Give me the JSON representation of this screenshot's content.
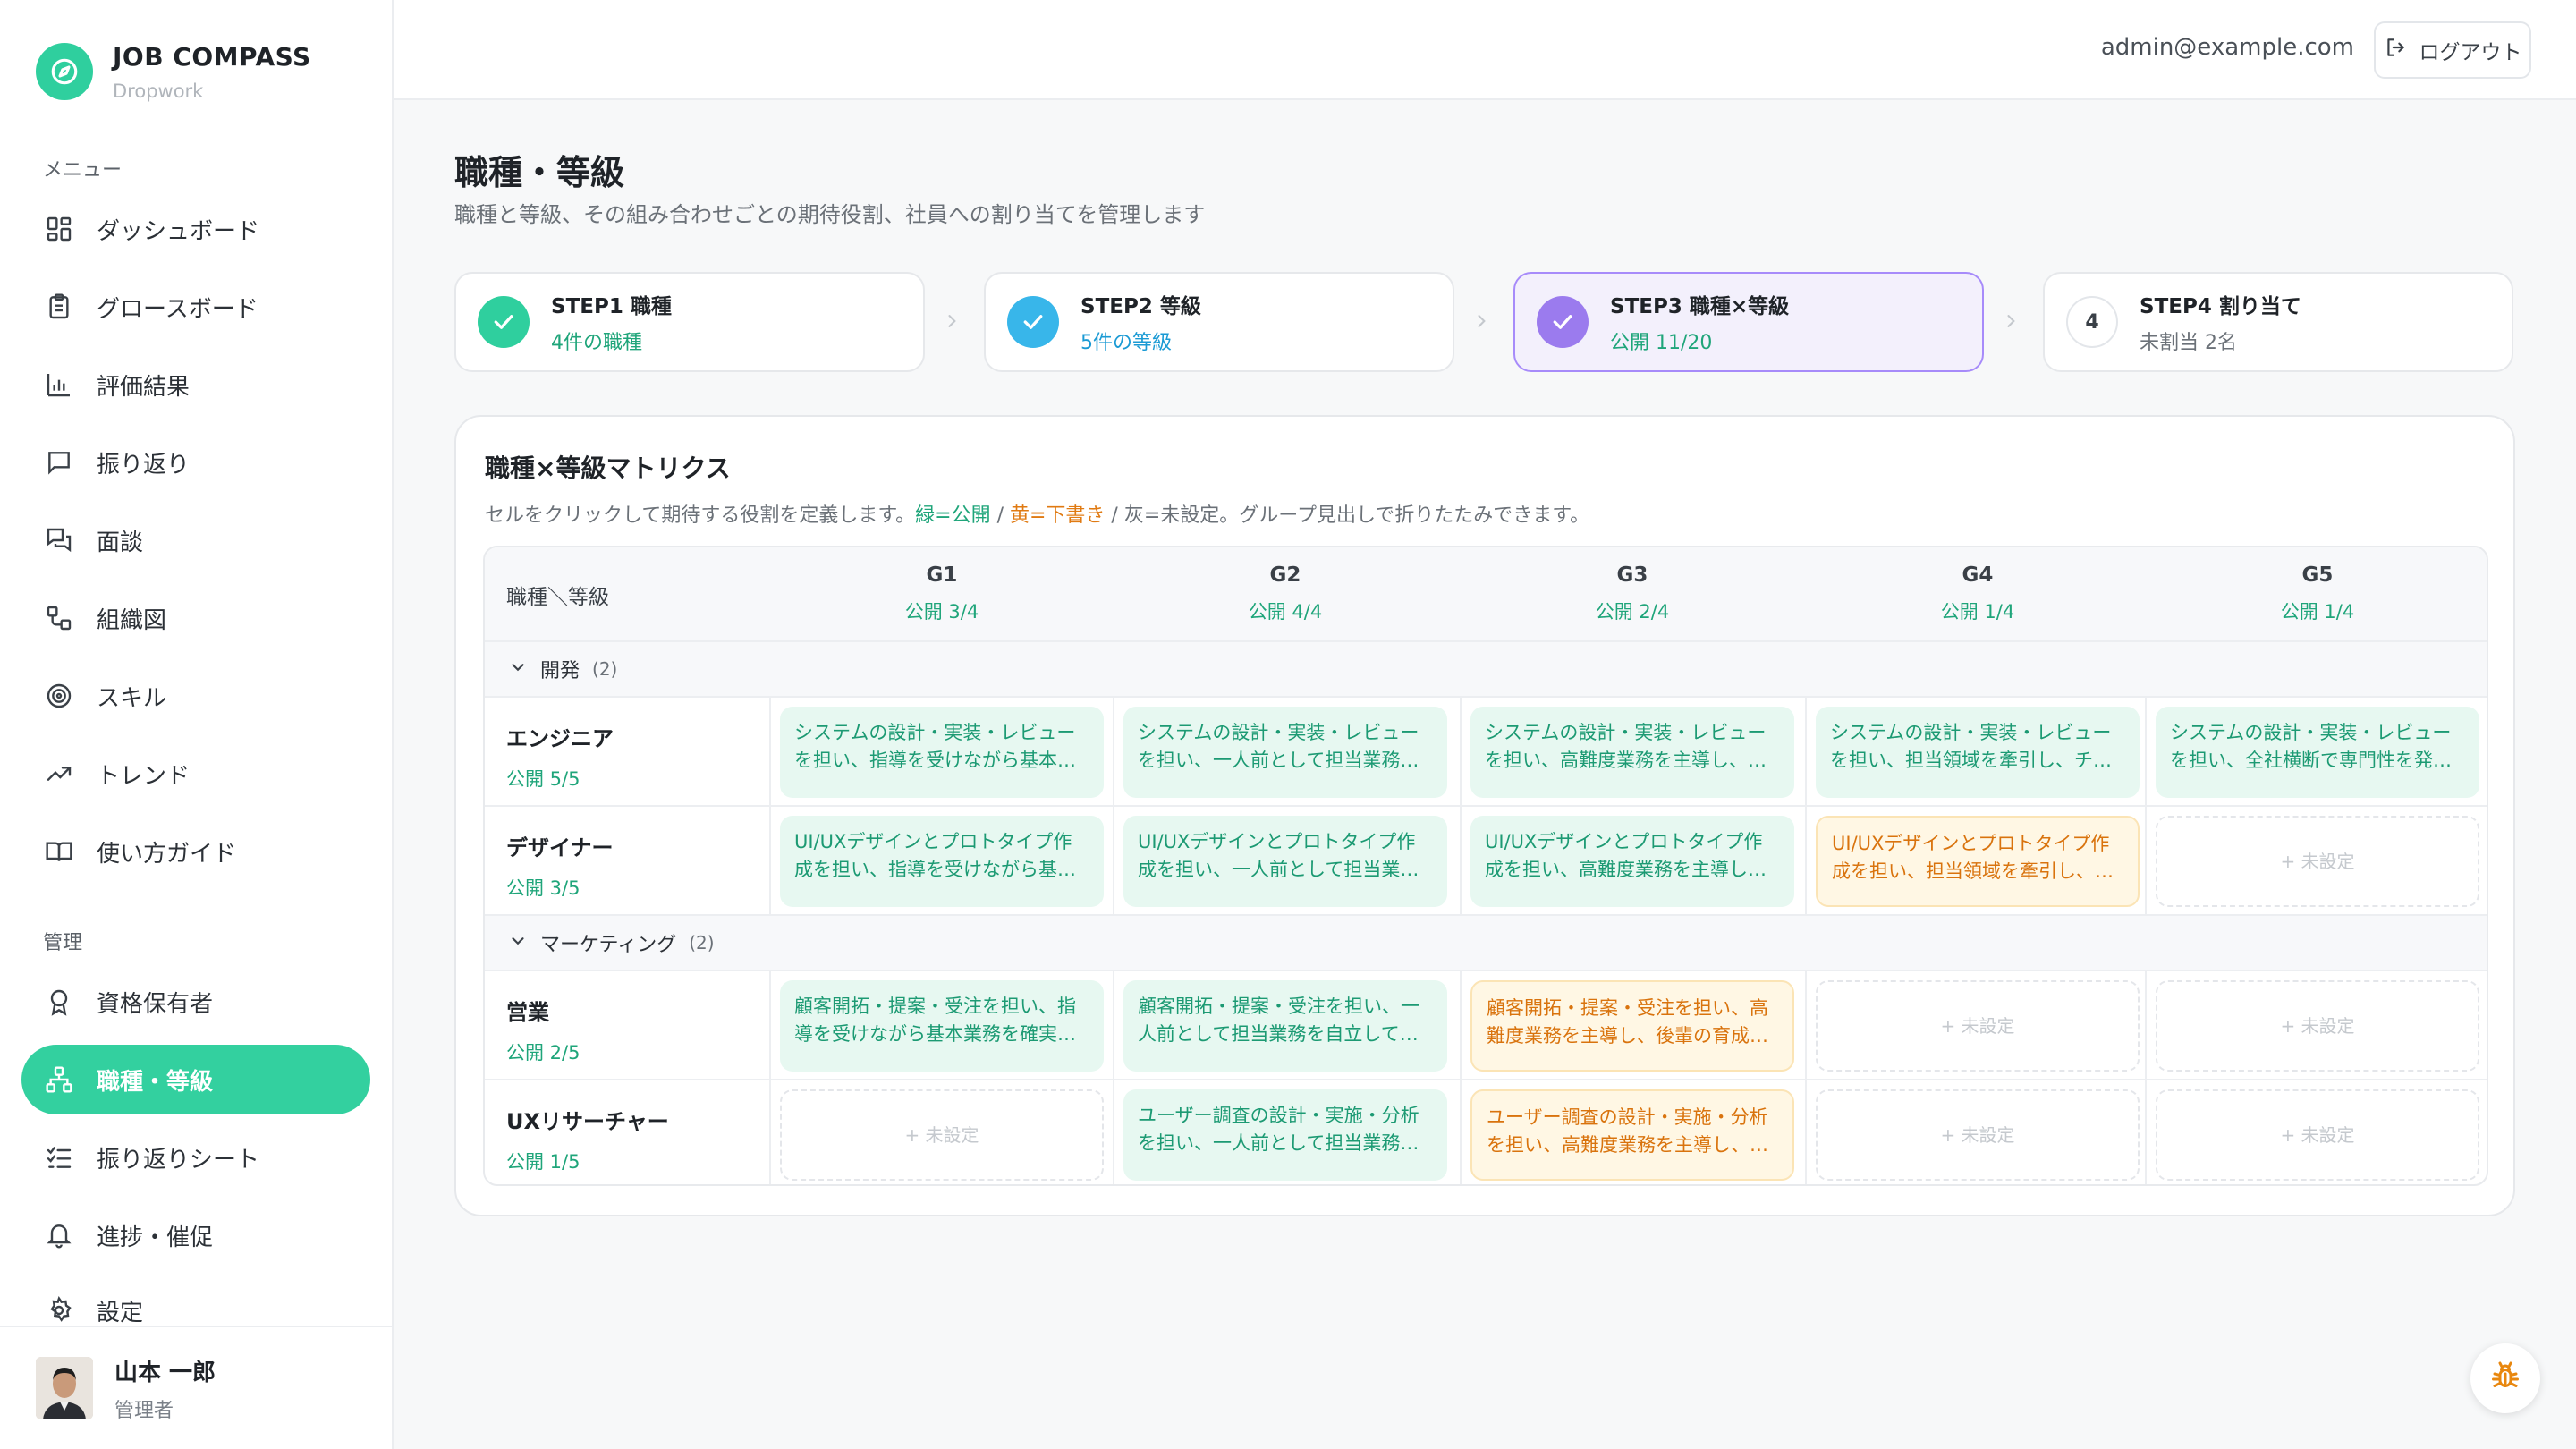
{
  "brand": {
    "name": "JOB COMPASS",
    "sub": "Dropwork"
  },
  "sidebar": {
    "menu_label": "メニュー",
    "menu_items": [
      {
        "label": "ダッシュボード",
        "icon": "dashboard-icon"
      },
      {
        "label": "グロースボード",
        "icon": "clipboard-icon"
      },
      {
        "label": "評価結果",
        "icon": "bar-chart-icon"
      },
      {
        "label": "振り返り",
        "icon": "message-square-icon"
      },
      {
        "label": "面談",
        "icon": "messages-icon"
      },
      {
        "label": "組織図",
        "icon": "org-chart-icon"
      },
      {
        "label": "スキル",
        "icon": "target-icon"
      },
      {
        "label": "トレンド",
        "icon": "trending-up-icon"
      },
      {
        "label": "使い方ガイド",
        "icon": "book-icon"
      }
    ],
    "admin_label": "管理",
    "admin_items": [
      {
        "label": "資格保有者",
        "icon": "award-icon"
      },
      {
        "label": "職種・等級",
        "icon": "hierarchy-icon",
        "active": true
      },
      {
        "label": "振り返りシート",
        "icon": "list-check-icon"
      },
      {
        "label": "進捗・催促",
        "icon": "bell-icon"
      },
      {
        "label": "設定",
        "icon": "gear-icon"
      }
    ]
  },
  "profile": {
    "name": "山本 一郎",
    "role": "管理者"
  },
  "topbar": {
    "email": "admin@example.com",
    "logout": "ログアウト"
  },
  "page": {
    "title": "職種・等級",
    "description": "職種と等級、その組み合わせごとの期待役割、社員への割り当てを管理します"
  },
  "steps": [
    {
      "title": "STEP1 職種",
      "sub": "4件の職種",
      "status": "done",
      "color": "#2fcf9e",
      "sub_color": "#1fa57a"
    },
    {
      "title": "STEP2 等級",
      "sub": "5件の等級",
      "status": "done",
      "color": "#38b6ea",
      "sub_color": "#1a9ad4"
    },
    {
      "title": "STEP3 職種×等級",
      "sub": "公開 11/20",
      "status": "current",
      "color": "#9b7bee",
      "sub_color": "#1fa57a"
    },
    {
      "title": "STEP4 割り当て",
      "sub": "未割当 2名",
      "status": "pending",
      "number": "4",
      "sub_color": "#6b7178"
    }
  ],
  "matrix": {
    "title": "職種×等級マトリクス",
    "desc_prefix": "セルをクリックして期待する役割を定義します。",
    "desc_green": "緑=公開",
    "desc_sep1": " / ",
    "desc_orange": "黄=下書き",
    "desc_sep2": " / ",
    "desc_suffix": "灰=未設定。グループ見出しで折りたたみできます。",
    "corner": "職種＼等級",
    "columns": [
      {
        "grade": "G1",
        "published": "公開 3/4"
      },
      {
        "grade": "G2",
        "published": "公開 4/4"
      },
      {
        "grade": "G3",
        "published": "公開 2/4"
      },
      {
        "grade": "G4",
        "published": "公開 1/4"
      },
      {
        "grade": "G5",
        "published": "公開 1/4"
      }
    ],
    "empty_label": "+ 未設定",
    "groups": [
      {
        "name": "開発",
        "count": "(2)",
        "rows": [
          {
            "name": "エンジニア",
            "published": "公開 5/5",
            "cells": [
              {
                "state": "pub",
                "text": "システムの設計・実装・レビューを担い、指導を受けながら基本業務を確実にこなす"
              },
              {
                "state": "pub",
                "text": "システムの設計・実装・レビューを担い、一人前として担当業務を自立して遂行する"
              },
              {
                "state": "pub",
                "text": "システムの設計・実装・レビューを担い、高難度業務を主導し、後輩の育成にも貢献する"
              },
              {
                "state": "pub",
                "text": "システムの設計・実装・レビューを担い、担当領域を牽引し、チームの成果に責任を持つ"
              },
              {
                "state": "pub",
                "text": "システムの設計・実装・レビューを担い、全社横断で専門性を発揮し、戦略を推進する"
              }
            ]
          },
          {
            "name": "デザイナー",
            "published": "公開 3/5",
            "cells": [
              {
                "state": "pub",
                "text": "UI/UXデザインとプロトタイプ作成を担い、指導を受けながら基本業務を確実にこなす"
              },
              {
                "state": "pub",
                "text": "UI/UXデザインとプロトタイプ作成を担い、一人前として担当業務を自立して遂行する"
              },
              {
                "state": "pub",
                "text": "UI/UXデザインとプロトタイプ作成を担い、高難度業務を主導し、後輩の育成にも貢献する"
              },
              {
                "state": "draft",
                "text": "UI/UXデザインとプロトタイプ作成を担い、担当領域を牽引し、チームの成果に責任を持つ"
              },
              {
                "state": "empty",
                "text": ""
              }
            ]
          }
        ]
      },
      {
        "name": "マーケティング",
        "count": "(2)",
        "rows": [
          {
            "name": "営業",
            "published": "公開 2/5",
            "cells": [
              {
                "state": "pub",
                "text": "顧客開拓・提案・受注を担い、指導を受けながら基本業務を確実にこなす"
              },
              {
                "state": "pub",
                "text": "顧客開拓・提案・受注を担い、一人前として担当業務を自立して遂行する"
              },
              {
                "state": "draft",
                "text": "顧客開拓・提案・受注を担い、高難度業務を主導し、後輩の育成にも貢献する"
              },
              {
                "state": "empty",
                "text": ""
              },
              {
                "state": "empty",
                "text": ""
              }
            ]
          },
          {
            "name": "UXリサーチャー",
            "published": "公開 1/5",
            "cells": [
              {
                "state": "empty",
                "text": ""
              },
              {
                "state": "pub",
                "text": "ユーザー調査の設計・実施・分析を担い、一人前として担当業務を自立して遂行する"
              },
              {
                "state": "draft",
                "text": "ユーザー調査の設計・実施・分析を担い、高難度業務を主導し、後輩の育成にも貢献する"
              },
              {
                "state": "empty",
                "text": ""
              },
              {
                "state": "empty",
                "text": ""
              }
            ]
          }
        ]
      }
    ]
  },
  "colors": {
    "accent": "#33d09f",
    "published": "#1fa57a",
    "draft": "#e07a12",
    "current_step": "#9b7bee"
  }
}
